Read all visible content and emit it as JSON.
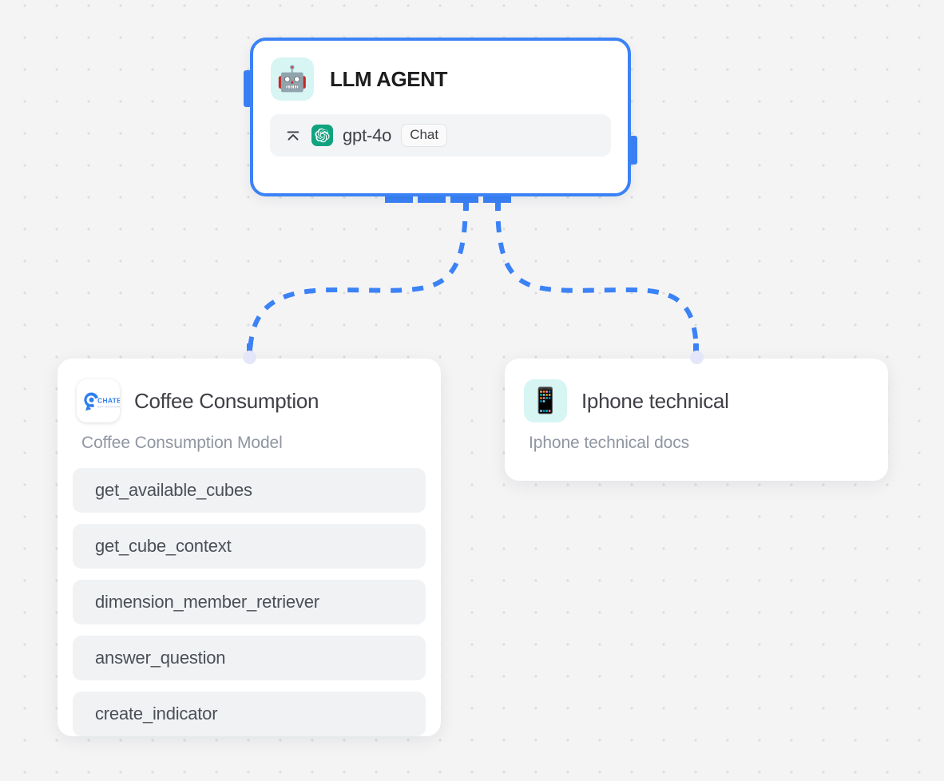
{
  "canvas": {
    "background_color": "#f4f4f5",
    "dot_color": "#dcdcdd",
    "edge_color": "#3b82f6",
    "handle_color": "#e6e6fa"
  },
  "agent_node": {
    "icon": "robot-emoji",
    "icon_glyph": "🤖",
    "title": "LLM AGENT",
    "border_color": "#3b82f6",
    "model": {
      "collapse_icon": "collapse-up-icon",
      "provider_icon": "openai-logo",
      "name": "gpt-4o",
      "badge": "Chat"
    }
  },
  "tool_node": {
    "icon": "chatbi-logo",
    "icon_text": "CHATBI",
    "icon_subtext": "GET DATA SMART",
    "title": "Coffee Consumption",
    "subtitle": "Coffee Consumption Model",
    "tools": [
      "get_available_cubes",
      "get_cube_context",
      "dimension_member_retriever",
      "answer_question",
      "create_indicator"
    ]
  },
  "doc_node": {
    "icon": "mobile-phone-emoji",
    "icon_glyph": "📱",
    "title": "Iphone technical",
    "subtitle": "Iphone technical docs"
  }
}
